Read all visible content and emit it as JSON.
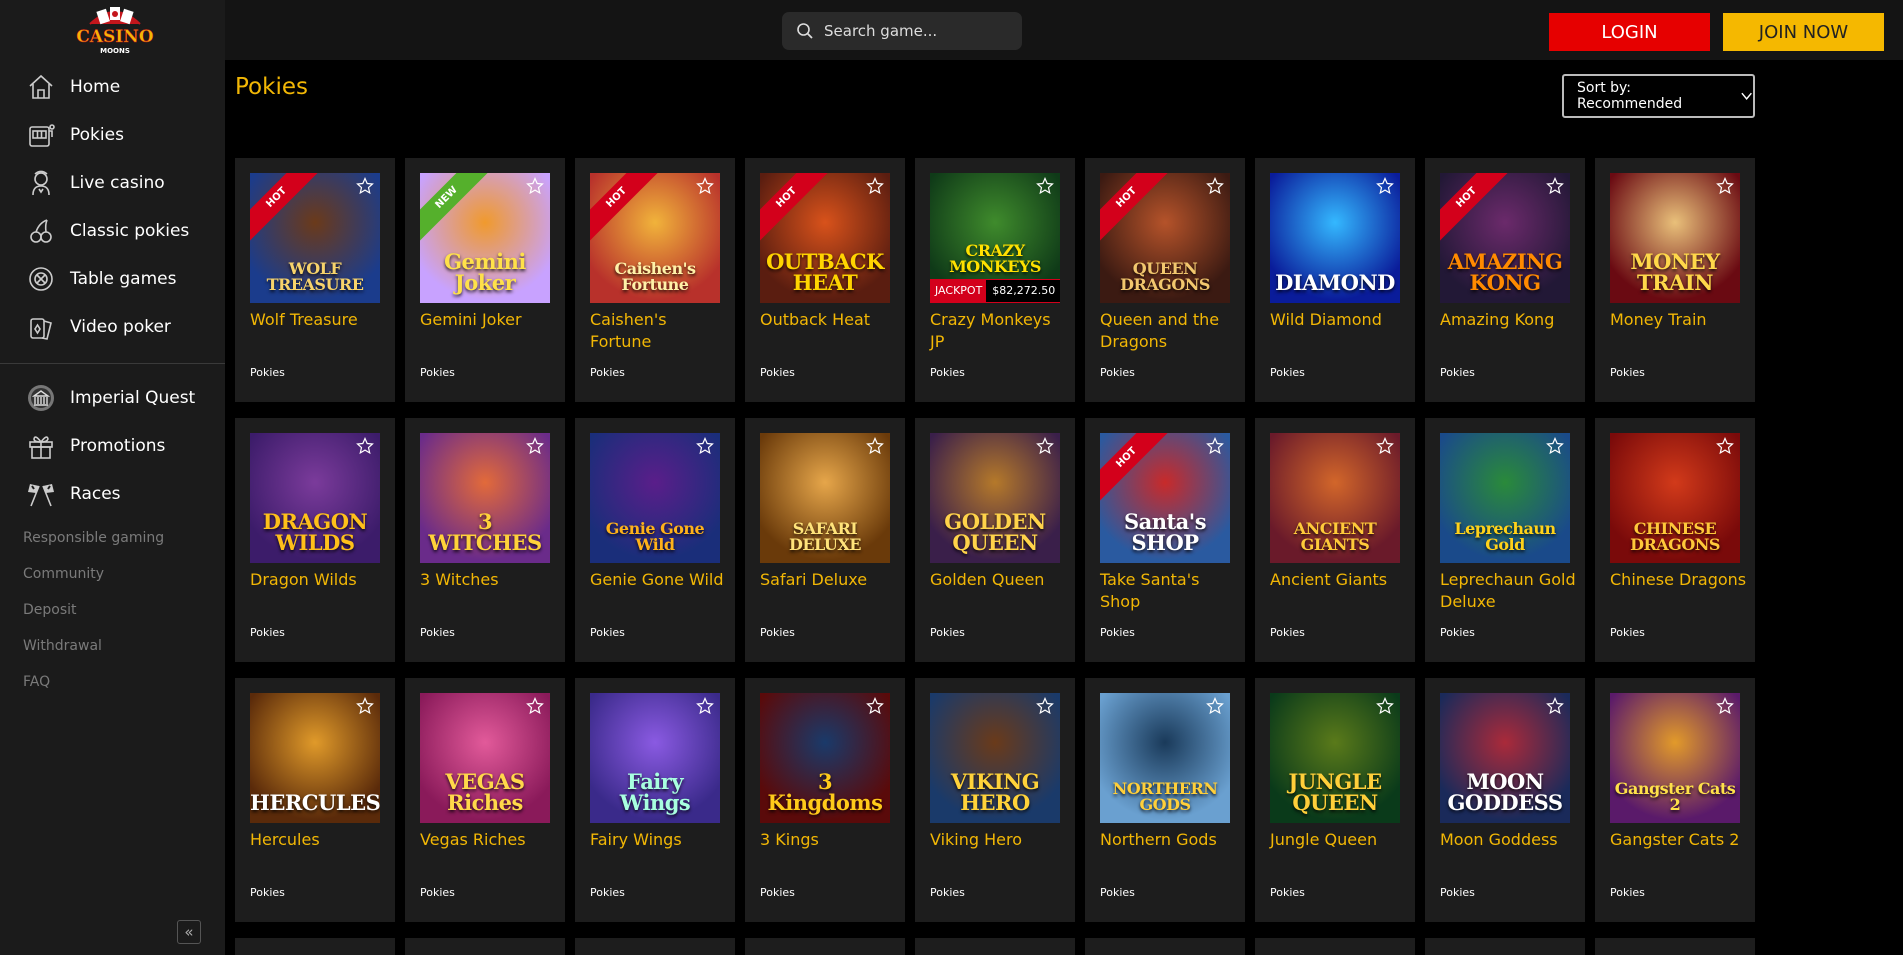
{
  "brand": {
    "line1": "CASINO",
    "line2": "MOONS"
  },
  "nav": [
    {
      "label": "Home",
      "icon": "home-icon"
    },
    {
      "label": "Pokies",
      "icon": "slot-machine-icon"
    },
    {
      "label": "Live casino",
      "icon": "dealer-icon"
    },
    {
      "label": "Classic pokies",
      "icon": "cherries-icon"
    },
    {
      "label": "Table games",
      "icon": "chip-icon"
    },
    {
      "label": "Video poker",
      "icon": "cards-icon"
    }
  ],
  "nav2": [
    {
      "label": "Imperial Quest",
      "icon": "temple-icon"
    },
    {
      "label": "Promotions",
      "icon": "gift-icon"
    },
    {
      "label": "Races",
      "icon": "race-flags-icon"
    }
  ],
  "links": [
    "Responsible gaming",
    "Community",
    "Deposit",
    "Withdrawal",
    "FAQ"
  ],
  "collapse_label": "«",
  "search": {
    "placeholder": "Search game..."
  },
  "buttons": {
    "login": "LOGIN",
    "join": "JOIN NOW"
  },
  "page_title": "Pokies",
  "sort": {
    "label": "Sort by: Recommended"
  },
  "colors": {
    "accent": "#f2b705",
    "login": "#e60000",
    "join": "#f5b800",
    "hot": "#d3001b",
    "new": "#55b02c"
  },
  "games": [
    {
      "name": "Wolf Treasure",
      "category": "Pokies",
      "badge": "HOT",
      "art": "WOLF TREASURE",
      "c1": "#1b3c8c",
      "c2": "#6b3a1a",
      "ac": "#f7d36b"
    },
    {
      "name": "Gemini Joker",
      "category": "Pokies",
      "badge": "NEW",
      "art": "Gemini Joker",
      "c1": "#c8a2ff",
      "c2": "#f09a2d",
      "ac": "#ffe14a"
    },
    {
      "name": "Caishen's Fortune",
      "category": "Pokies",
      "badge": "HOT",
      "art": "Caishen's Fortune",
      "c1": "#b8312b",
      "c2": "#f1b33b",
      "ac": "#fff1a8"
    },
    {
      "name": "Outback Heat",
      "category": "Pokies",
      "badge": "HOT",
      "art": "OUTBACK HEAT",
      "c1": "#5a1d10",
      "c2": "#d8521b",
      "ac": "#ffd400"
    },
    {
      "name": "Crazy Monkeys JP",
      "category": "Pokies",
      "badge": "",
      "art": "CRAZY MONKEYS",
      "c1": "#0f3a18",
      "c2": "#3f8b2c",
      "ac": "#ffe100",
      "jackpot_label": "JACKPOT",
      "jackpot_value": "$82,272.50"
    },
    {
      "name": "Queen and the Dragons",
      "category": "Pokies",
      "badge": "HOT",
      "art": "QUEEN DRAGONS",
      "c1": "#3b1a12",
      "c2": "#b5532a",
      "ac": "#f2c76e"
    },
    {
      "name": "Wild Diamond",
      "category": "Pokies",
      "badge": "",
      "art": "DIAMOND",
      "c1": "#0a1c9a",
      "c2": "#34b8ff",
      "ac": "#ffffff"
    },
    {
      "name": "Amazing Kong",
      "category": "Pokies",
      "badge": "HOT",
      "art": "AMAZING KONG",
      "c1": "#221836",
      "c2": "#6b2a6b",
      "ac": "#ff8a00"
    },
    {
      "name": "Money Train",
      "category": "Pokies",
      "badge": "",
      "art": "MONEY TRAIN",
      "c1": "#6a0a12",
      "c2": "#e9c07a",
      "ac": "#ffd84a"
    },
    {
      "name": "Dragon Wilds",
      "category": "Pokies",
      "badge": "",
      "art": "DRAGON WILDS",
      "c1": "#3c1c6a",
      "c2": "#7b3b9b",
      "ac": "#ffc01a"
    },
    {
      "name": "3 Witches",
      "category": "Pokies",
      "badge": "",
      "art": "3 WITCHES",
      "c1": "#6a2b8a",
      "c2": "#e26a3a",
      "ac": "#ffd23a"
    },
    {
      "name": "Genie Gone Wild",
      "category": "Pokies",
      "badge": "",
      "art": "Genie Gone Wild",
      "c1": "#1a2e7a",
      "c2": "#5a1e8a",
      "ac": "#ffb21a"
    },
    {
      "name": "Safari Deluxe",
      "category": "Pokies",
      "badge": "",
      "art": "SAFARI DELUXE",
      "c1": "#6a3a0a",
      "c2": "#e6a64a",
      "ac": "#ffe37a"
    },
    {
      "name": "Golden Queen",
      "category": "Pokies",
      "badge": "",
      "art": "GOLDEN QUEEN",
      "c1": "#3a1f4a",
      "c2": "#b5792a",
      "ac": "#ffd34a"
    },
    {
      "name": "Take Santa's Shop",
      "category": "Pokies",
      "badge": "HOT",
      "art": "Santa's SHOP",
      "c1": "#2a5aa0",
      "c2": "#c82a2a",
      "ac": "#ffffff"
    },
    {
      "name": "Ancient Giants",
      "category": "Pokies",
      "badge": "",
      "art": "ANCIENT GIANTS",
      "c1": "#6a1a2a",
      "c2": "#d2662a",
      "ac": "#ffca3a"
    },
    {
      "name": "Leprechaun Gold Deluxe",
      "category": "Pokies",
      "badge": "",
      "art": "Leprechaun Gold",
      "c1": "#1a4a8a",
      "c2": "#2a8a3a",
      "ac": "#ffd21a"
    },
    {
      "name": "Chinese Dragons",
      "category": "Pokies",
      "badge": "",
      "art": "CHINESE DRAGONS",
      "c1": "#7a0a0a",
      "c2": "#d23a1a",
      "ac": "#ffc83a"
    },
    {
      "name": "Hercules",
      "category": "Pokies",
      "badge": "",
      "art": "HERCULES",
      "c1": "#5a2a0a",
      "c2": "#e09a2a",
      "ac": "#ffffff"
    },
    {
      "name": "Vegas Riches",
      "category": "Pokies",
      "badge": "",
      "art": "VEGAS Riches",
      "c1": "#8a1a5a",
      "c2": "#e25a9a",
      "ac": "#ffd84a"
    },
    {
      "name": "Fairy Wings",
      "category": "Pokies",
      "badge": "",
      "art": "Fairy Wings",
      "c1": "#3a2a8a",
      "c2": "#8a5ae2",
      "ac": "#a8ffe0"
    },
    {
      "name": "3 Kings",
      "category": "Pokies",
      "badge": "",
      "art": "3 Kingdoms",
      "c1": "#5a0a0a",
      "c2": "#1a3a6a",
      "ac": "#ffca1a"
    },
    {
      "name": "Viking Hero",
      "category": "Pokies",
      "badge": "",
      "art": "VIKING HERO",
      "c1": "#1a3a6a",
      "c2": "#6a3a1a",
      "ac": "#ffd23a"
    },
    {
      "name": "Northern Gods",
      "category": "Pokies",
      "badge": "",
      "art": "NORTHERN GODS",
      "c1": "#6aa0d0",
      "c2": "#1a3a5a",
      "ac": "#ffcf3a"
    },
    {
      "name": "Jungle Queen",
      "category": "Pokies",
      "badge": "",
      "art": "JUNGLE QUEEN",
      "c1": "#0a3a1a",
      "c2": "#5a7a1a",
      "ac": "#ffcf3a"
    },
    {
      "name": "Moon Goddess",
      "category": "Pokies",
      "badge": "",
      "art": "MOON GODDESS",
      "c1": "#1a2a5a",
      "c2": "#aa2a3a",
      "ac": "#ffffff"
    },
    {
      "name": "Gangster Cats 2",
      "category": "Pokies",
      "badge": "",
      "art": "Gangster Cats 2",
      "c1": "#5a1a6a",
      "c2": "#e29a2a",
      "ac": "#ffe14a"
    }
  ]
}
